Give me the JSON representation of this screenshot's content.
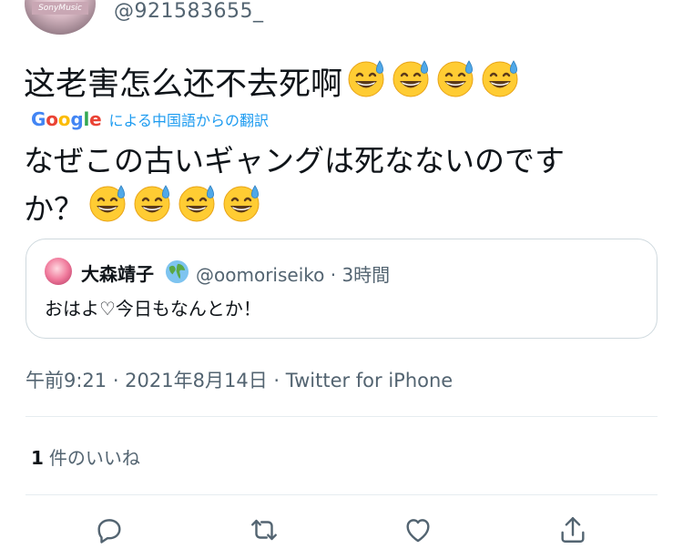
{
  "author": {
    "handle": "@921583655_",
    "avatar_caption": "SonyMusic"
  },
  "tweet": {
    "original_text": "这老害怎么还不去死啊",
    "original_emoji_count": 4,
    "emoji_name": "grinning-face-with-sweat",
    "translation_brand": "Google",
    "translation_label": "による中国語からの翻訳",
    "translated_line1": "なぜこの古いギャングは死なないのです",
    "translated_line2": "か？",
    "translated_emoji_count": 4
  },
  "quoted_tweet": {
    "name": "大森靖子",
    "badge_icon": "globe-emoji",
    "handle": "@oomoriseiko",
    "separator": "·",
    "time": "3時間",
    "text": "おはよ♡今日もなんとか！"
  },
  "meta": {
    "timestamp": "午前9:21 · 2021年8月14日 · Twitter for iPhone"
  },
  "likes": {
    "count": "1",
    "label": "件のいいね"
  },
  "actions": [
    "reply-icon",
    "retweet-icon",
    "like-icon",
    "share-icon"
  ],
  "colors": {
    "link_blue": "#1d9bf0",
    "secondary_text": "#536471",
    "border": "#cfd9de",
    "icon": "#536471",
    "google_blue": "#4285F4",
    "google_red": "#EA4335",
    "google_yellow": "#FBBC05",
    "google_green": "#34A853"
  }
}
